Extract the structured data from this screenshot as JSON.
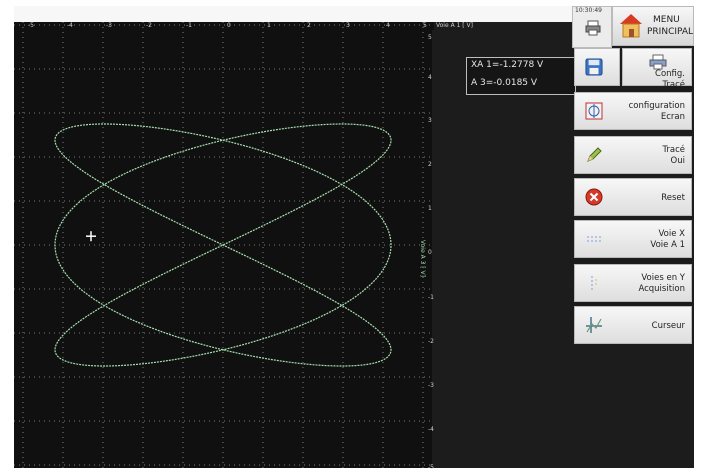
{
  "header": {
    "clock": "10:30:49",
    "menu_line1": "MENU",
    "menu_line2": "PRINCIPAL"
  },
  "plot": {
    "x_ticks": [
      "-5",
      "-4",
      "-3",
      "-2",
      "-1",
      "0",
      "1",
      "2",
      "3",
      "4",
      "5"
    ],
    "x_axis_label": "Voie A 1 [ V]",
    "y_ticks": [
      "5",
      "4",
      "3",
      "2",
      "1",
      "0",
      "-1",
      "-2",
      "-3",
      "-4",
      "-5"
    ],
    "y_axis_label": "Voie A 3 [ V]",
    "trace_color": "#a8e0b0",
    "background_color": "#101010"
  },
  "readout": {
    "line1": "XA 1=-1.2778 V",
    "line2": "A 3=-0.0185 V"
  },
  "sidebar": {
    "config_trace": "Config.\nTracé",
    "configuration_ecran": "configuration\nEcran",
    "trace": "Tracé\nOui",
    "reset": "Reset",
    "voie_x": "Voie  X\nVoie A 1",
    "voies_y": "Voies en Y\nAcquisition",
    "curseur": "Curseur"
  }
}
